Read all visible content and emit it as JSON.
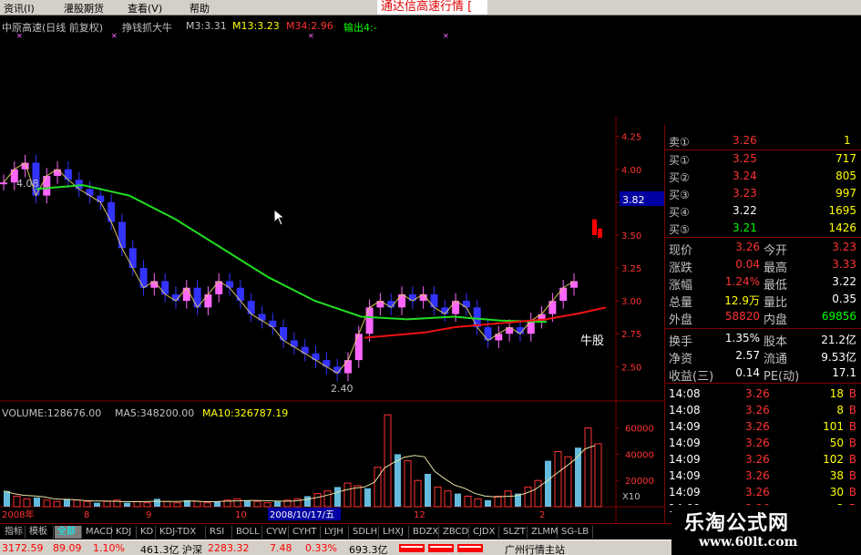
{
  "menu": {
    "items": [
      "资讯(I)",
      "灌股期货",
      "查看(V)",
      "帮助"
    ],
    "brand": "通达信高速行情 ["
  },
  "title": {
    "stock": "中原高速(日线 前复权)",
    "indicator": "挣钱抓大牛",
    "m3": "M3:3.31",
    "m13": "M13:3.23",
    "m34": "M34:2.96",
    "output": "输出4:-"
  },
  "chart_data": {
    "type": "line",
    "price_axis_ticks": [
      "4.25",
      "4.00",
      "3.75",
      "3.50",
      "3.25",
      "3.00",
      "2.75",
      "2.50"
    ],
    "current_price_tag": "3.82",
    "high_label": "4.08",
    "low_label": "2.40",
    "stock_label": "牛股",
    "x_labels": [
      "2008年",
      "8",
      "9",
      "10",
      "2008/10/17/五",
      "12",
      "2"
    ],
    "closes": [
      3.9,
      4.0,
      4.05,
      3.8,
      3.95,
      4.0,
      3.92,
      3.85,
      3.8,
      3.75,
      3.6,
      3.4,
      3.25,
      3.1,
      3.15,
      3.05,
      3.0,
      3.1,
      2.95,
      3.05,
      3.15,
      3.1,
      3.0,
      2.9,
      2.85,
      2.8,
      2.7,
      2.65,
      2.6,
      2.55,
      2.5,
      2.45,
      2.55,
      2.75,
      2.95,
      3.0,
      2.95,
      3.05,
      3.0,
      3.05,
      2.95,
      2.9,
      3.0,
      2.95,
      2.8,
      2.7,
      2.75,
      2.8,
      2.75,
      2.85,
      2.9,
      3.0,
      3.1,
      3.15
    ],
    "ma_green": [
      3.85,
      3.88,
      3.8,
      3.62,
      3.4,
      3.18,
      3.0,
      2.88,
      2.86,
      2.88,
      2.85,
      2.84
    ],
    "ma_red": [
      2.72,
      2.74,
      2.76,
      2.8,
      2.82,
      2.84,
      2.86,
      2.9,
      2.95
    ],
    "volume": {
      "label": "VOLUME:128676.00",
      "ma5": "MA5:348200.00",
      "ma10": "MA10:326787.19",
      "axis_ticks": [
        "60000",
        "40000",
        "20000"
      ],
      "unit": "X10",
      "values": [
        12,
        8,
        6,
        7,
        5,
        4,
        6,
        5,
        4,
        3,
        4,
        5,
        3,
        4,
        3,
        6,
        4,
        3,
        5,
        4,
        3,
        4,
        5,
        6,
        5,
        4,
        3,
        4,
        5,
        6,
        8,
        10,
        12,
        15,
        18,
        16,
        14,
        30,
        70,
        40,
        35,
        20,
        25,
        15,
        12,
        10,
        8,
        6,
        5,
        8,
        12,
        10,
        15,
        20,
        35,
        42,
        38,
        45,
        60,
        48
      ]
    }
  },
  "quote": {
    "sell_top": {
      "label": "卖①",
      "price": "3.26",
      "vol": "1"
    },
    "buys": [
      {
        "label": "买①",
        "price": "3.25",
        "vol": "717"
      },
      {
        "label": "买②",
        "price": "3.24",
        "vol": "805"
      },
      {
        "label": "买③",
        "price": "3.23",
        "vol": "997"
      },
      {
        "label": "买④",
        "price": "3.22",
        "vol": "1695"
      },
      {
        "label": "买⑤",
        "price": "3.21",
        "vol": "1426"
      }
    ],
    "stats": [
      {
        "l1": "现价",
        "v1": "3.26",
        "l2": "今开",
        "v2": "3.23"
      },
      {
        "l1": "涨跌",
        "v1": "0.04",
        "l2": "最高",
        "v2": "3.33"
      },
      {
        "l1": "涨幅",
        "v1": "1.24%",
        "l2": "最低",
        "v2": "3.22"
      },
      {
        "l1": "总量",
        "v1": "12.9万",
        "l2": "量比",
        "v2": "0.35"
      },
      {
        "l1": "外盘",
        "v1": "58820",
        "l2": "内盘",
        "v2": "69856"
      }
    ],
    "stats2": [
      {
        "l1": "换手",
        "v1": "1.35%",
        "l2": "股本",
        "v2": "21.2亿"
      },
      {
        "l1": "净资",
        "v1": "2.57",
        "l2": "流通",
        "v2": "9.53亿"
      },
      {
        "l1": "收益(三)",
        "v1": "0.14",
        "l2": "PE(动)",
        "v2": "17.1"
      }
    ],
    "ticks": [
      {
        "time": "14:08",
        "price": "3.26",
        "vol": "18",
        "side": "B"
      },
      {
        "time": "14:08",
        "price": "3.26",
        "vol": "8",
        "side": "B"
      },
      {
        "time": "14:09",
        "price": "3.26",
        "vol": "101",
        "side": "B"
      },
      {
        "time": "14:09",
        "price": "3.26",
        "vol": "50",
        "side": "B"
      },
      {
        "time": "14:09",
        "price": "3.26",
        "vol": "102",
        "side": "B"
      },
      {
        "time": "14:09",
        "price": "3.26",
        "vol": "38",
        "side": "B"
      },
      {
        "time": "14:09",
        "price": "3.26",
        "vol": "30",
        "side": "B"
      },
      {
        "time": "14:09",
        "price": "3.26",
        "vol": "3",
        "side": "B"
      }
    ],
    "period": "日线"
  },
  "tabs": [
    "指标",
    "模板",
    "全部",
    "MACD",
    "KDJ",
    "KD",
    "KDJ-TDX",
    "RSI",
    "BOLL",
    "CYW",
    "CYHT",
    "LYJH",
    "SDLH",
    "LHXJ",
    "BDZX",
    "ZBCD",
    "CJDX",
    "SLZT",
    "ZLMM",
    "SG-LB"
  ],
  "status": {
    "sh_index": "3172.59",
    "sh_change": "89.09",
    "sh_pct": "1.10%",
    "sh_amount": "461.3亿",
    "sz_name": "沪深",
    "sz_index": "2283.32",
    "sz_change": "7.48",
    "sz_pct": "0.33%",
    "sz_amount": "693.3亿",
    "station": "广州行情主站"
  },
  "watermark": {
    "title": "乐淘公式网",
    "url": "www.60lt.com"
  },
  "colors": {
    "up": "#ff3232",
    "down": "#00ffff",
    "accent": "#ffff00",
    "grid": "#800000"
  }
}
